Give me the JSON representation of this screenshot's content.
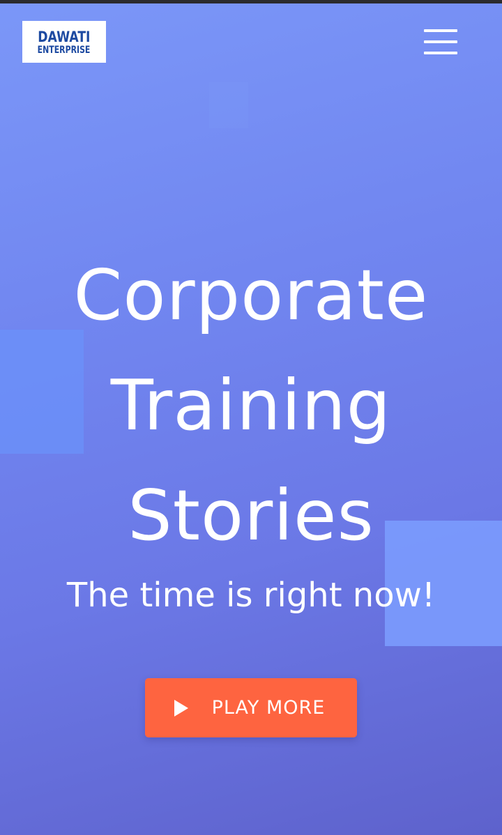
{
  "header": {
    "logo": {
      "line1": "DAWATI",
      "line2": "ENTERPRISE"
    },
    "menu_icon": "hamburger-menu-icon"
  },
  "hero": {
    "title_lines": [
      "Corporate",
      "Training",
      "Stories"
    ],
    "subtitle": "The time is right now!",
    "cta": {
      "label": "PLAY MORE",
      "icon": "play-icon"
    }
  },
  "colors": {
    "background_start": "#7b97f8",
    "background_end": "#5e62cc",
    "cta": "#fe6440",
    "logo_text": "#1d4aa1",
    "text": "#ffffff"
  }
}
